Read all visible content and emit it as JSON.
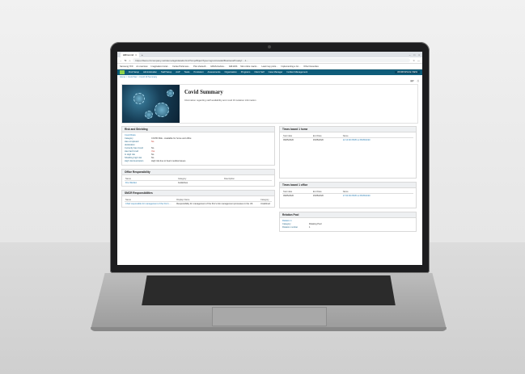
{
  "browser": {
    "tab_title": "HRConn2",
    "url": "https://demo.hrcompany.net/demo/ags/details.html?cmp/0bjectType=ogrom/ewdet/BusinessPnuaty/....1...",
    "window_controls": [
      "–",
      "□",
      "×"
    ],
    "bookmarks": [
      "Samsung YF9",
      "An overview",
      "Imaginative knowl...",
      "Fertas Portal ass...",
      "Ptsc shareoft...",
      "HR&S-Fedora...",
      "IHR-ESS",
      "Met online macto...",
      "Learn key ports...",
      "Implementing a Co...",
      "Other favourites"
    ]
  },
  "app_nav": {
    "items": [
      "Find Setup",
      "Administration",
      "Staff Setup",
      "AAP",
      "Tasks",
      "Persistent",
      "Assessments",
      "Organisation",
      "Programs",
      "Client Self",
      "Case Manager",
      "Incident Management"
    ],
    "right_label": "WORKSPACE VIEW"
  },
  "breadcrumb": "Home > Covid Set > Covid 19 Summary",
  "hero": {
    "title": "Covid Summary",
    "subtitle": "Information regarding staff availability and covid 19 isolation information"
  },
  "risk_panel": {
    "title": "Risk and Shielding",
    "subhead": "Covid Risks",
    "rows": [
      {
        "label": "Category",
        "value": "COVID Risk - Available for home and office",
        "red": false
      },
      {
        "label": "Has completed declaration",
        "value": "No",
        "red": true
      },
      {
        "label": "Currently has Covid",
        "value": "No",
        "red": false
      },
      {
        "label": "Has had Covid",
        "value": "Yes",
        "red": true
      },
      {
        "label": "In High risk",
        "value": "No",
        "red": false
      },
      {
        "label": "Shielding high risk",
        "value": "No",
        "red": false
      },
      {
        "label": "High risk description",
        "value": "High risk due to heart medical issues",
        "red": false
      }
    ]
  },
  "office_panel": {
    "title": "Office Responsibility",
    "headers": [
      "Name",
      "Category",
      "Description"
    ],
    "rows": [
      [
        "Fire Warden",
        "Guidelines",
        ""
      ]
    ]
  },
  "smcr_panel": {
    "title": "SMCR Responsibilities",
    "headers": [
      "Name",
      "Display Name",
      "Category"
    ],
    "rows": [
      [
        "Chief responsible for management of the firm's ...",
        "Responsibility for management of the firm's risk management processes in the UK",
        "Undefined"
      ]
    ]
  },
  "home_panel": {
    "title": "Times based 1 home",
    "headers": [
      "Start date",
      "End Date",
      "Name"
    ],
    "rows": [
      [
        "09/05/2020",
        "15/05/2020",
        "12 10:00 05/05 to 05/05/2020"
      ]
    ]
  },
  "office_times_panel": {
    "title": "Times based 1 office",
    "headers": [
      "Start date",
      "End Date",
      "Name"
    ],
    "rows": [
      [
        "09/05/2020",
        "15/05/2020",
        "17:00:09 05/05 to 05/05/2020"
      ]
    ]
  },
  "relation_panel": {
    "title": "Relation Pool",
    "subhead": "Relation 1",
    "rows": [
      {
        "label": "Category",
        "value": "Rotating Pool"
      },
      {
        "label": "Rotation number",
        "value": "1"
      }
    ]
  }
}
